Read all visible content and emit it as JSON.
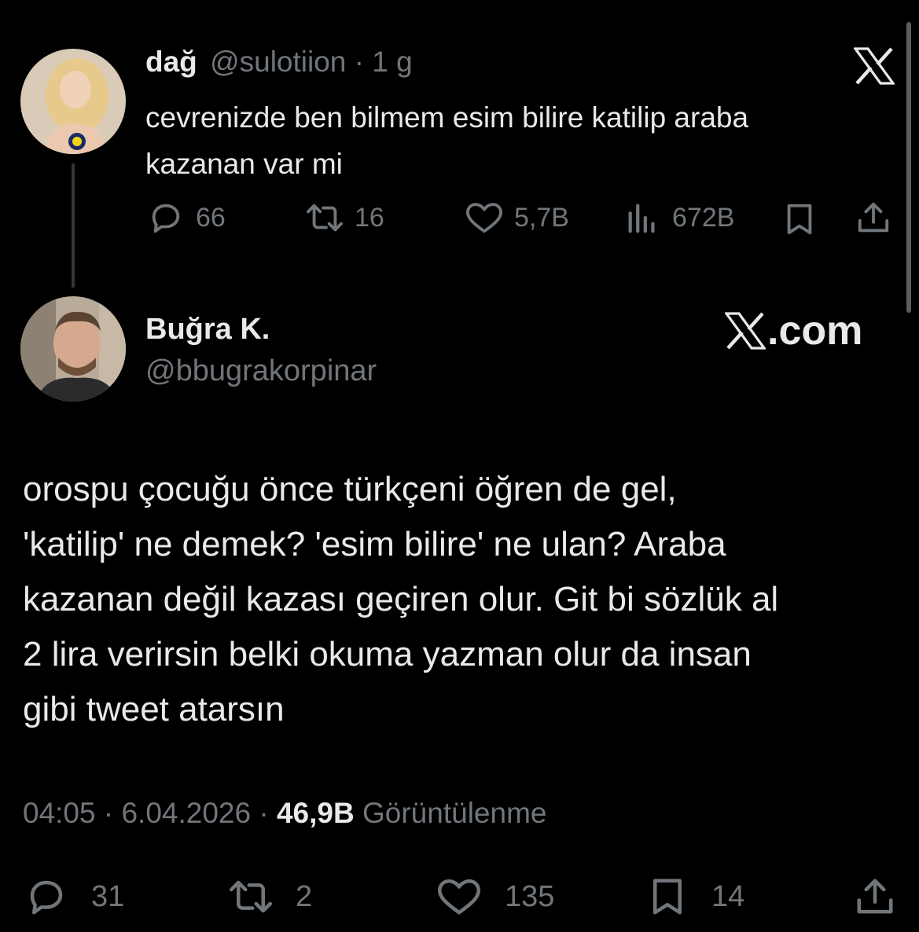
{
  "quoted_tweet": {
    "display_name": "dağ",
    "handle": "@sulotiion",
    "separator": "·",
    "age": "1 g",
    "text_line1": "cevrenizde ben bilmem esim bilire katilip araba",
    "text_line2": "kazanan var mi",
    "stats": {
      "replies": "66",
      "reposts": "16",
      "likes": "5,7B",
      "views": "672B"
    }
  },
  "main_tweet": {
    "display_name": "Buğra K.",
    "handle": "@bbugrakorpinar",
    "text_lines": [
      "orospu çocuğu önce türkçeni öğren de gel,",
      "'katilip' ne demek? 'esim bilire' ne ulan? Araba",
      "kazanan değil kazası geçiren olur. Git bi sözlük al",
      "2 lira verirsin belki okuma yazman olur da insan",
      "gibi tweet atarsın"
    ],
    "time": "04:05",
    "date": "6.04.2026",
    "sep": "·",
    "view_count": "46,9B",
    "view_label": "Görüntülenme",
    "stats": {
      "replies": "31",
      "reposts": "2",
      "likes": "135",
      "bookmarks": "14"
    }
  },
  "watermark": {
    "domain_text": ".com"
  },
  "icons": {
    "x_logo": "x-logo-icon",
    "reply": "reply-icon",
    "repost": "repost-icon",
    "like": "heart-icon",
    "views": "views-chart-icon",
    "bookmark": "bookmark-icon",
    "share": "share-icon"
  },
  "colors": {
    "background": "#000000",
    "text": "#e7e9ea",
    "muted": "#71767b"
  }
}
